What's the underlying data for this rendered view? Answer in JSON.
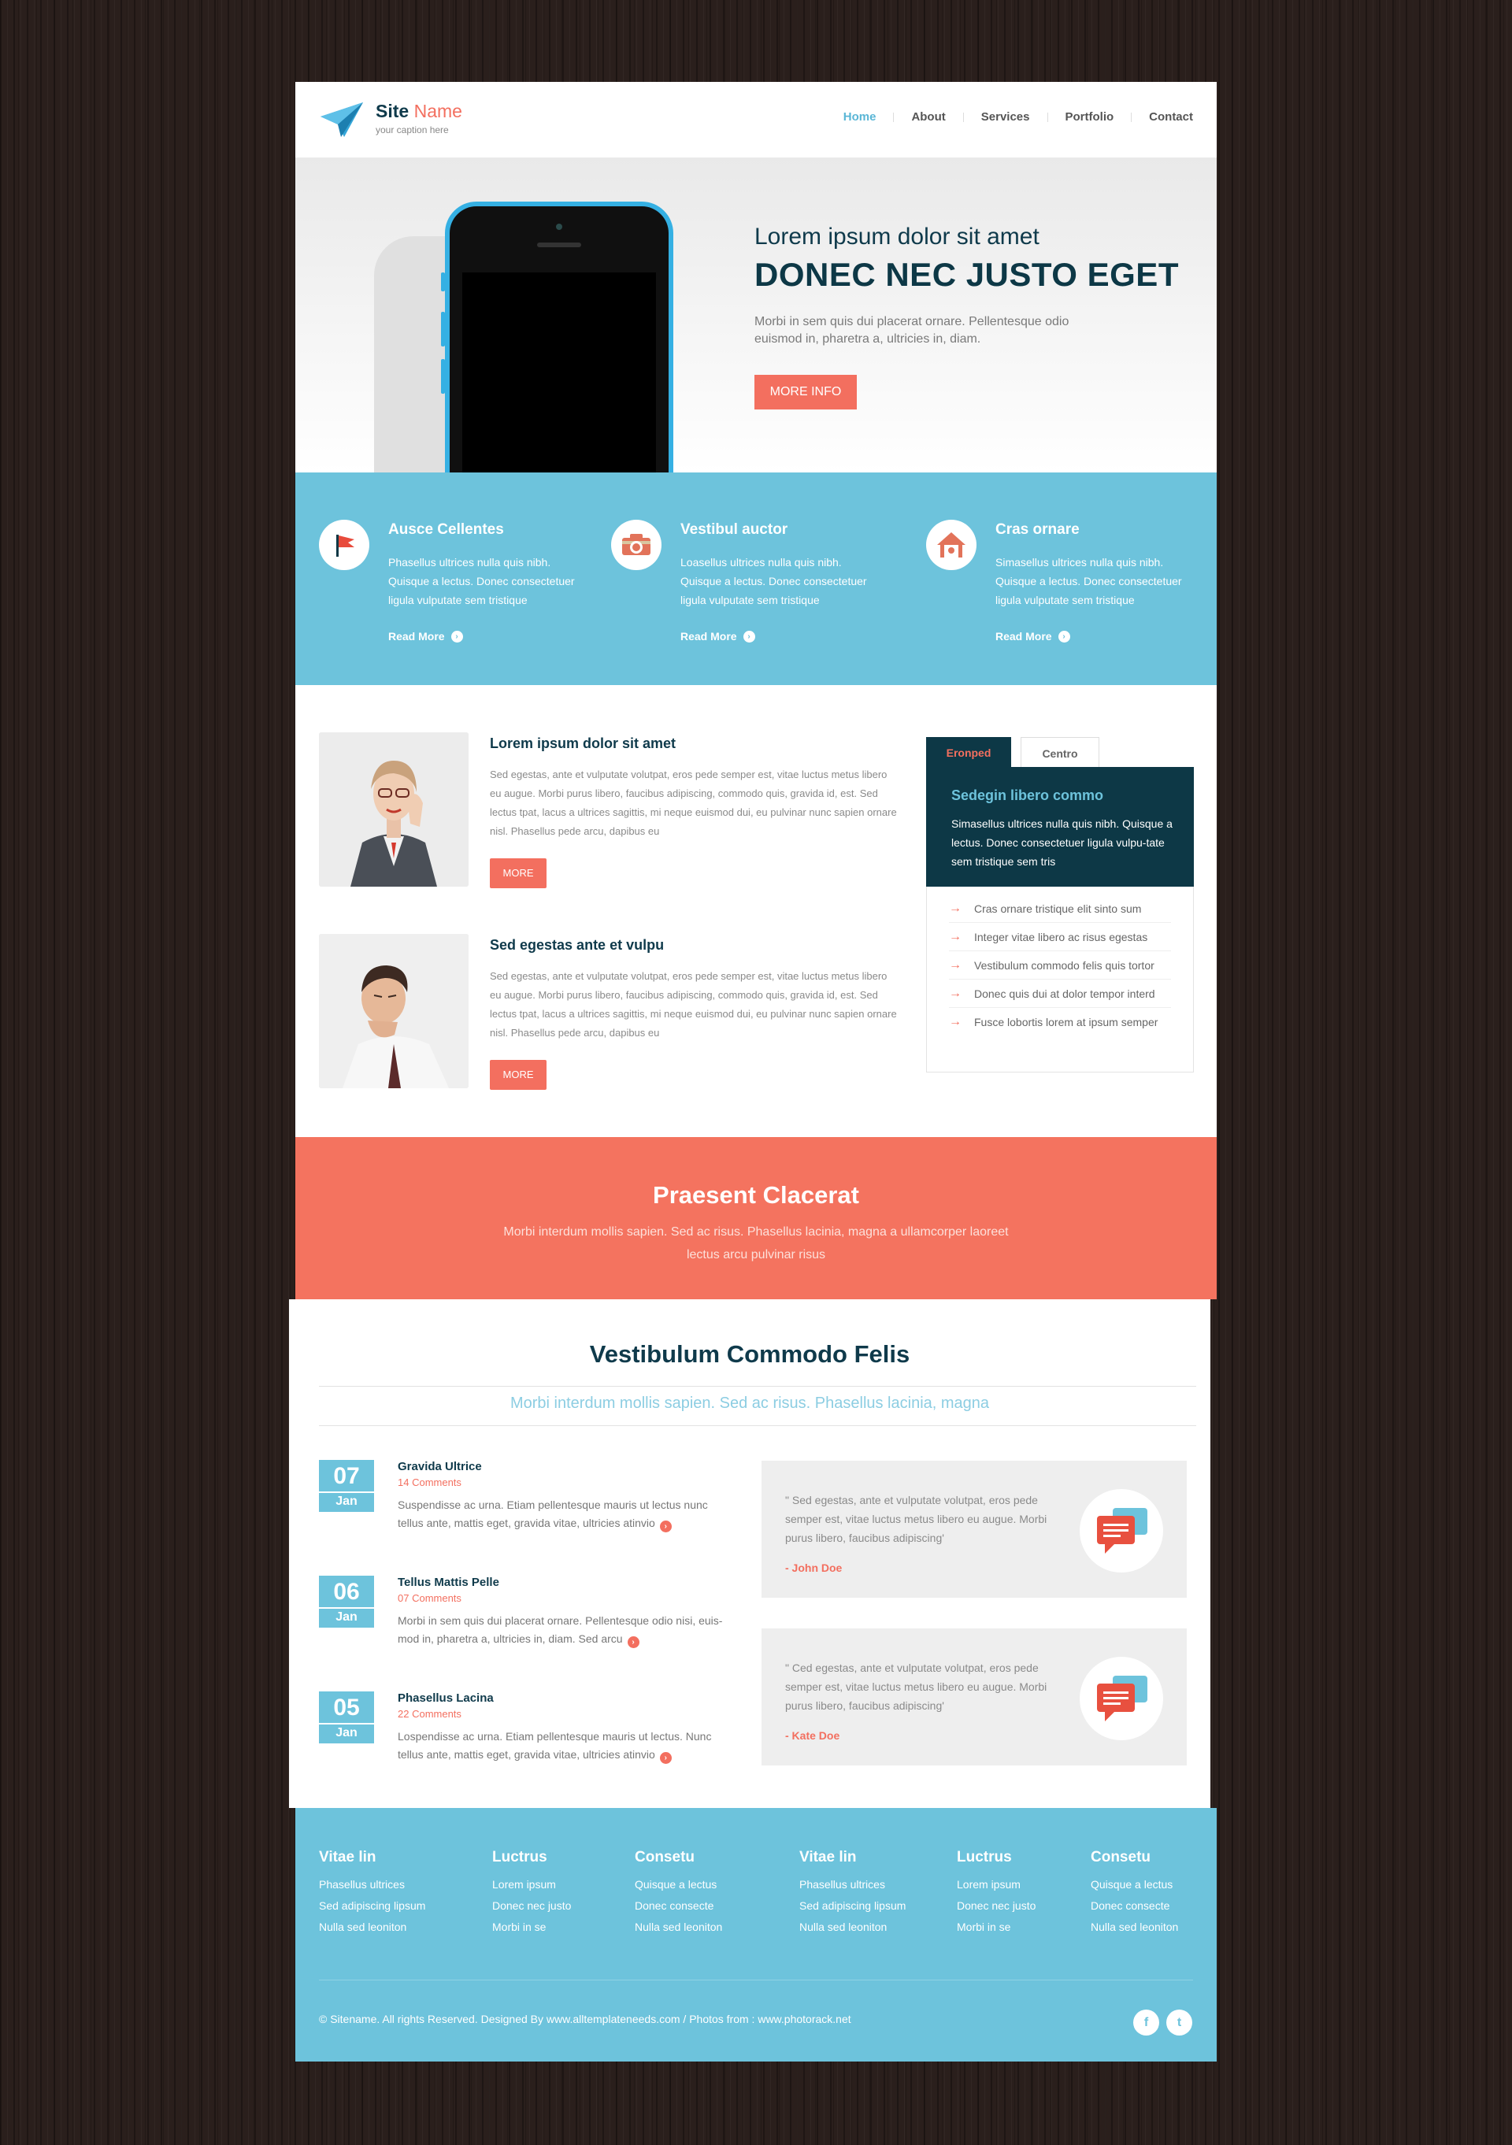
{
  "header": {
    "logo": {
      "site": "Site",
      "name": "Name",
      "caption": "your caption here"
    },
    "nav": [
      {
        "label": "Home",
        "active": true
      },
      {
        "label": "About"
      },
      {
        "label": "Services"
      },
      {
        "label": "Portfolio"
      },
      {
        "label": "Contact"
      }
    ]
  },
  "hero": {
    "subtitle": "Lorem ipsum dolor sit amet",
    "title": "DONEC NEC JUSTO EGET",
    "text": "Morbi in sem quis dui placerat ornare. Pellentesque odio euismod in, pharetra a, ultricies in, diam.",
    "button": "MORE INFO"
  },
  "features": [
    {
      "title": "Ausce Cellentes",
      "text": "Phasellus ultrices nulla quis nibh. Quisque a lectus. Donec consectetuer ligula vulputate sem tristique",
      "link": "Read More",
      "icon": "flag-icon"
    },
    {
      "title": "Vestibul auctor",
      "text": "Loasellus ultrices nulla quis nibh. Quisque a lectus. Donec consectetuer ligula vulputate sem tristique",
      "link": "Read More",
      "icon": "camera-icon"
    },
    {
      "title": "Cras ornare",
      "text": "Simasellus ultrices nulla quis nibh. Quisque a lectus. Donec consectetuer ligula vulputate sem tristique",
      "link": "Read More",
      "icon": "home-icon"
    }
  ],
  "posts": [
    {
      "title": "Lorem ipsum dolor sit amet",
      "text": "Sed egestas, ante et vulputate volutpat, eros pede semper est, vitae luctus metus libero eu augue. Morbi purus libero, faucibus adipiscing, commodo quis, gravida id, est. Sed lectus tpat, lacus a ultrices sagittis, mi neque euismod dui, eu pulvinar nunc sapien ornare nisl. Phasellus pede arcu, dapibus eu",
      "button": "MORE"
    },
    {
      "title": "Sed egestas ante et vulpu",
      "text": "Sed egestas, ante et vulputate volutpat, eros pede semper est, vitae luctus metus libero eu augue. Morbi purus libero, faucibus adipiscing, commodo quis, gravida id, est. Sed lectus tpat, lacus a ultrices sagittis, mi neque euismod dui, eu pulvinar nunc sapien ornare nisl. Phasellus pede arcu, dapibus eu",
      "button": "MORE"
    }
  ],
  "tabs": {
    "labels": [
      "Eronped",
      "Centro"
    ],
    "box_title": "Sedegin libero commo",
    "box_text": "Simasellus ultrices nulla quis nibh. Quisque a lectus. Donec consectetuer ligula vulpu-tate sem tristique sem tris",
    "list": [
      "Cras ornare tristique elit  sinto sum",
      "Integer vitae libero ac risus egestas",
      "Vestibulum commodo felis quis tortor",
      "Donec quis dui at dolor tempor interd",
      "Fusce lobortis lorem at ipsum semper"
    ]
  },
  "banner": {
    "title": "Praesent Clacerat",
    "text": "Morbi interdum mollis sapien. Sed ac risus. Phasellus lacinia, magna a ullamcorper laoreet lectus arcu pulvinar risus"
  },
  "news": {
    "title": "Vestibulum Commodo Felis",
    "subtitle": "Morbi interdum mollis sapien. Sed ac risus. Phasellus lacinia, magna",
    "events": [
      {
        "day": "07",
        "month": "Jan",
        "title": "Gravida Ultrice",
        "comments": "14 Comments",
        "text": "Suspendisse ac urna. Etiam pellentesque mauris ut lectus nunc tellus ante, mattis eget, gravida vitae, ultricies atinvio"
      },
      {
        "day": "06",
        "month": "Jan",
        "title": "Tellus Mattis Pelle",
        "comments": "07 Comments",
        "text": "Morbi in sem quis dui placerat ornare. Pellentesque odio nisi, euis-mod in, pharetra a, ultricies in, diam. Sed arcu"
      },
      {
        "day": "05",
        "month": "Jan",
        "title": "Phasellus Lacina",
        "comments": "22 Comments",
        "text": "Lospendisse ac urna. Etiam pellentesque mauris ut lectus. Nunc tellus ante, mattis eget, gravida vitae, ultricies atinvio"
      }
    ],
    "quotes": [
      {
        "text": "\" Sed egestas, ante et vulputate volutpat, eros pede semper est, vitae luctus metus libero eu augue. Morbi purus libero, faucibus adipiscing'",
        "author": "- John Doe"
      },
      {
        "text": "\" Ced egestas, ante et vulputate volutpat, eros pede semper est, vitae luctus metus libero eu augue. Morbi purus libero, faucibus adipiscing'",
        "author": "- Kate Doe"
      }
    ]
  },
  "footer": {
    "columns": [
      {
        "title": "Vitae lin",
        "links": [
          "Phasellus ultrices",
          "Sed adipiscing lipsum",
          "Nulla sed leoniton"
        ]
      },
      {
        "title": "Luctrus",
        "links": [
          "Lorem ipsum",
          "Donec nec justo",
          "Morbi in se"
        ]
      },
      {
        "title": "Consetu",
        "links": [
          "Quisque a lectus",
          "Donec consecte",
          "Nulla sed leoniton"
        ]
      },
      {
        "title": "Vitae lin",
        "links": [
          "Phasellus ultrices",
          "Sed adipiscing lipsum",
          "Nulla sed leoniton"
        ]
      },
      {
        "title": "Luctrus",
        "links": [
          "Lorem ipsum",
          "Donec nec justo",
          "Morbi in se"
        ]
      },
      {
        "title": "Consetu",
        "links": [
          "Quisque a lectus",
          "Donec consecte",
          "Nulla sed leoniton"
        ]
      }
    ],
    "copyright": "© Sitename. All rights Reserved. Designed By www.alltemplateneeds.com   /   Photos from : www.photorack.net",
    "social": [
      "f",
      "t"
    ]
  },
  "colors": {
    "accent": "#6dc3dc",
    "coral": "#f36f5f",
    "navy": "#0d3846"
  }
}
